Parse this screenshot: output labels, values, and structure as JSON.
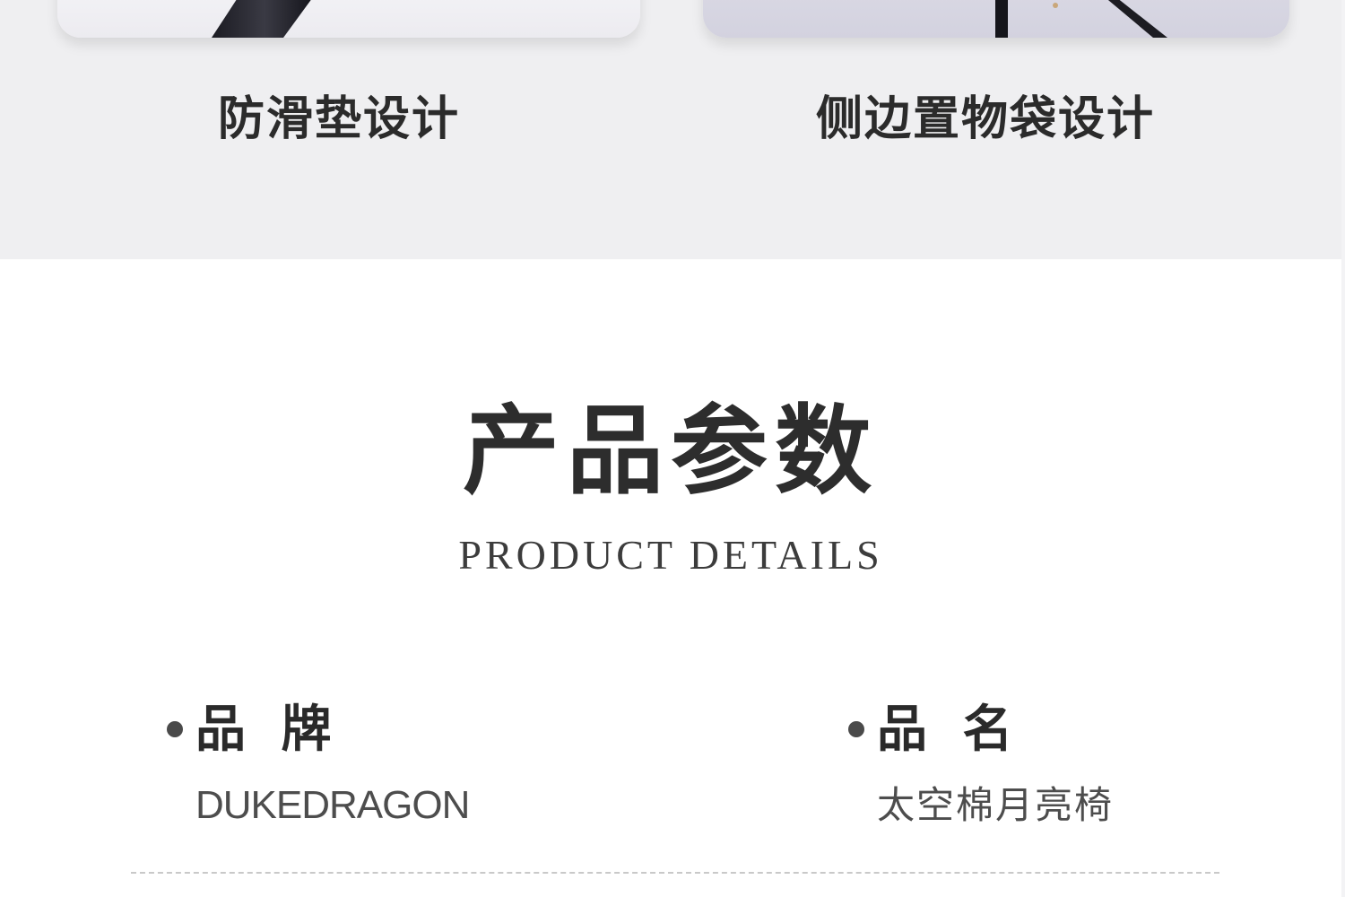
{
  "features": {
    "left_label": "防滑垫设计",
    "right_label": "侧边置物袋设计"
  },
  "section": {
    "title": "产品参数",
    "subtitle": "PRODUCT DETAILS"
  },
  "params": [
    {
      "label": "品 牌",
      "value": "DUKEDRAGON"
    },
    {
      "label": "品 名",
      "value": "太空棉月亮椅"
    }
  ],
  "colors": {
    "top_band": "#efeff1",
    "text_dark": "#2b2b2b",
    "value_text": "#4d4d4d",
    "divider": "#c9c9c9"
  }
}
